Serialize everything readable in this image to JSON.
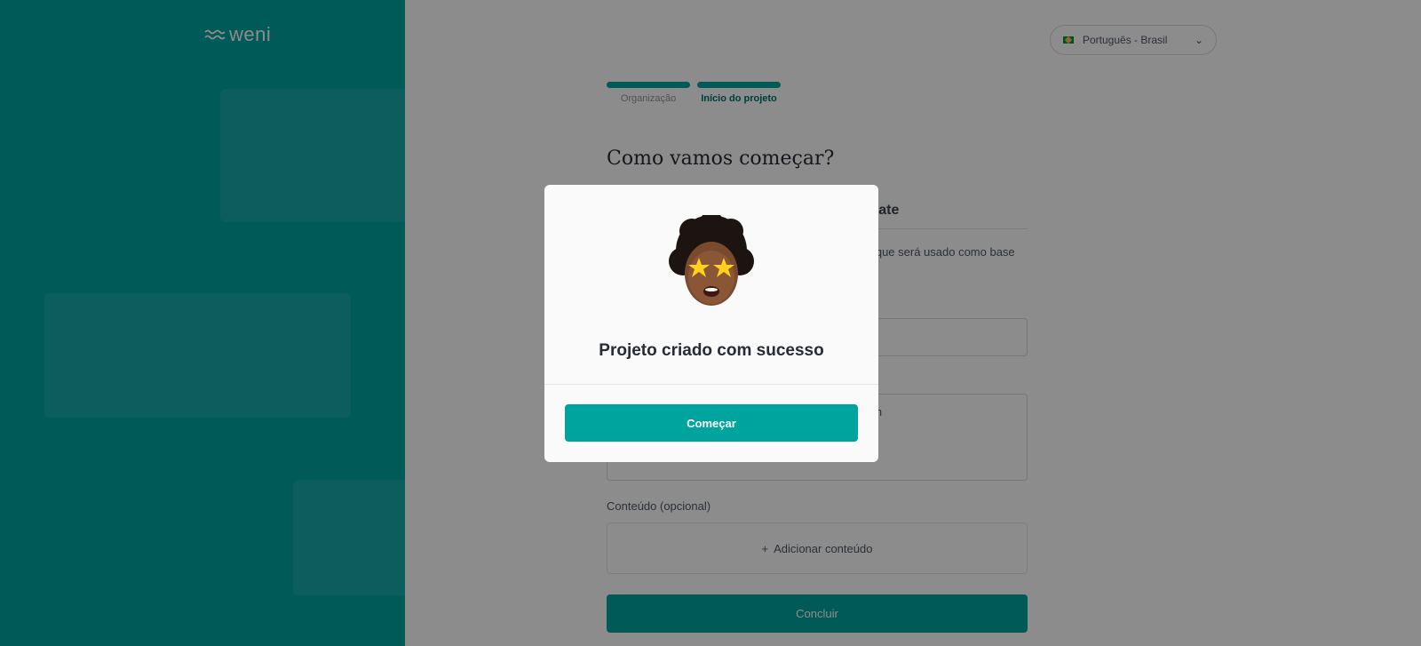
{
  "brand": {
    "logo_text": "weni",
    "logo_icon": "wave-icon"
  },
  "language": {
    "value": "Português - Brasil",
    "flag": "brazil-flag-icon"
  },
  "steps": [
    {
      "label": "Organização",
      "active": false
    },
    {
      "label": "Início do projeto",
      "active": true
    }
  ],
  "page": {
    "title": "Como vamos começar?",
    "tab_visible": "plate",
    "description_visible": "o que será usado como base",
    "field2_visible": "dm",
    "content_label": "Conteúdo (opcional)",
    "add_content": "Adicionar conteúdo",
    "conclude_button": "Concluir"
  },
  "modal": {
    "title": "Projeto criado com sucesso",
    "button": "Começar",
    "image": "memoji-star-eyes"
  },
  "colors": {
    "accent": "#00A49F",
    "overlay": "rgba(0,0,0,0.45)"
  }
}
